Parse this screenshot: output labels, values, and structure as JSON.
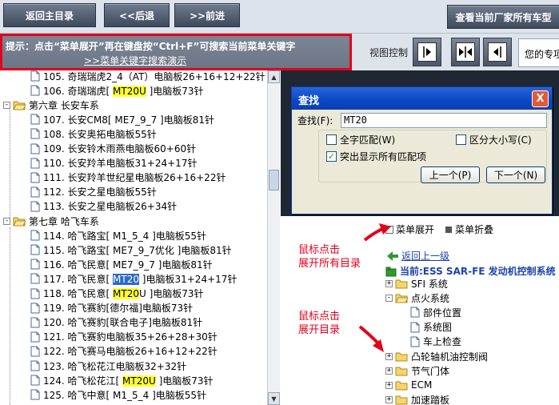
{
  "toolbar": {
    "home_label": "返回主目录",
    "back_label": "<<后退",
    "forward_label": ">>前进",
    "manufacturer_label": "查看当前厂家所有车型"
  },
  "hint": {
    "text": "提示：点击“菜单展开”再在键盘按“Ctrl+F”可搜索当前菜单关键字",
    "link": ">>菜单关键字搜索演示"
  },
  "view_control": {
    "label": "视图控制",
    "cut_text": "您的专项"
  },
  "tree": {
    "rows": [
      {
        "type": "doc",
        "parts": [
          {
            "t": "105. 奇瑞瑞虎2_4（AT）电脑板26+16+12+22针"
          }
        ]
      },
      {
        "type": "doc",
        "parts": [
          {
            "t": "106. 奇瑞瑞虎[ "
          },
          {
            "t": "MT20U",
            "hl": "yellow"
          },
          {
            "t": " ]电脑板73针"
          }
        ]
      },
      {
        "type": "folder",
        "parts": [
          {
            "t": "第六章 长安车系"
          }
        ]
      },
      {
        "type": "doc",
        "parts": [
          {
            "t": "107. 长安CM8[ ME7_9_7 ]电脑板81针"
          }
        ]
      },
      {
        "type": "doc",
        "parts": [
          {
            "t": "108. 长安奥拓电脑板55针"
          }
        ]
      },
      {
        "type": "doc",
        "parts": [
          {
            "t": "109. 长安铃木雨燕电脑板60+60针"
          }
        ]
      },
      {
        "type": "doc",
        "parts": [
          {
            "t": "110. 长安羚羊电脑板31+24+17针"
          }
        ]
      },
      {
        "type": "doc",
        "parts": [
          {
            "t": "111. 长安羚羊世纪星电脑板26+16+22针"
          }
        ]
      },
      {
        "type": "doc",
        "parts": [
          {
            "t": "112. 长安之星电脑板55针"
          }
        ]
      },
      {
        "type": "doc",
        "parts": [
          {
            "t": "113. 长安之星电脑板26+34针"
          }
        ]
      },
      {
        "type": "folder",
        "parts": [
          {
            "t": "第七章 哈飞车系"
          }
        ]
      },
      {
        "type": "doc",
        "parts": [
          {
            "t": "114. 哈飞路宝[ M1_5_4 ]电脑板55针"
          }
        ]
      },
      {
        "type": "doc",
        "parts": [
          {
            "t": "115. 哈飞路宝[ ME7_9_7优化 ]电脑板81针"
          }
        ]
      },
      {
        "type": "doc",
        "parts": [
          {
            "t": "116. 哈飞民意[ ME7_9_7 ]电脑板81针"
          }
        ]
      },
      {
        "type": "doc",
        "parts": [
          {
            "t": "117. 哈飞民意[ "
          },
          {
            "t": "MT20",
            "hl": "blue"
          },
          {
            "t": " ]电脑板31+24+17针"
          }
        ]
      },
      {
        "type": "doc",
        "parts": [
          {
            "t": "118. 哈飞民意[ "
          },
          {
            "t": "MT20",
            "hl": "yellow"
          },
          {
            "t": "U ]电脑板73针"
          }
        ]
      },
      {
        "type": "doc",
        "parts": [
          {
            "t": "119. 哈飞赛豹[德尔福]电脑板73针"
          }
        ]
      },
      {
        "type": "doc",
        "parts": [
          {
            "t": "120. 哈飞赛豹[联合电子]电脑板81针"
          }
        ]
      },
      {
        "type": "doc",
        "parts": [
          {
            "t": "121. 哈飞赛豹电脑板35+26+28+30针"
          }
        ]
      },
      {
        "type": "doc",
        "parts": [
          {
            "t": "122. 哈飞赛马电脑板26+16+12+22针"
          }
        ]
      },
      {
        "type": "doc",
        "parts": [
          {
            "t": "123. 哈飞松花江电脑板32+32针"
          }
        ]
      },
      {
        "type": "doc",
        "parts": [
          {
            "t": "124. 哈飞松花江[ "
          },
          {
            "t": "MT20U",
            "hl": "yellow"
          },
          {
            "t": " ]电脑板73针"
          }
        ]
      },
      {
        "type": "doc",
        "parts": [
          {
            "t": "125. 哈飞中意[ M1_5_4 ]电脑板55针"
          }
        ]
      }
    ]
  },
  "find_dialog": {
    "title": "查找",
    "find_label": "查找(F):",
    "find_value": "MT20",
    "whole_word": "全字匹配(W)",
    "match_case": "区分大小写(C)",
    "highlight_all": "突出显示所有匹配项",
    "prev_button": "上一个(P)",
    "next_button": "下一个(N)",
    "close_symbol": "X"
  },
  "menu": {
    "expand_label": "菜单展开",
    "collapse_label": "菜单折叠"
  },
  "annotations": {
    "note1_line1": "鼠标点击",
    "note1_line2": "展开所有目录",
    "note2_line1": "鼠标点击",
    "note2_line2": "展开目录"
  },
  "right_tree": {
    "back_link": "返回上一级",
    "current_label": "当前:ESS SAR-FE 发动机控制系统",
    "rows": [
      {
        "type": "folder",
        "label": "SFI 系统",
        "expander": "+"
      },
      {
        "type": "folder-open",
        "label": "点火系统",
        "expander": "-"
      },
      {
        "type": "doc",
        "label": "部件位置"
      },
      {
        "type": "doc",
        "label": "系统图"
      },
      {
        "type": "doc",
        "label": "车上检查"
      },
      {
        "type": "folder",
        "label": "凸轮轴机油控制阀",
        "expander": "+"
      },
      {
        "type": "folder",
        "label": "节气门体",
        "expander": "+"
      },
      {
        "type": "folder",
        "label": "ECM",
        "expander": "+"
      },
      {
        "type": "folder",
        "label": "加速踏板",
        "expander": "+"
      }
    ]
  },
  "colors": {
    "accent_red": "#e3001b",
    "highlight_yellow": "#ffff33",
    "highlight_blue": "#2d6ac7",
    "toolbar_button": "#4b5668",
    "dialog_title": "#0a48c6"
  }
}
